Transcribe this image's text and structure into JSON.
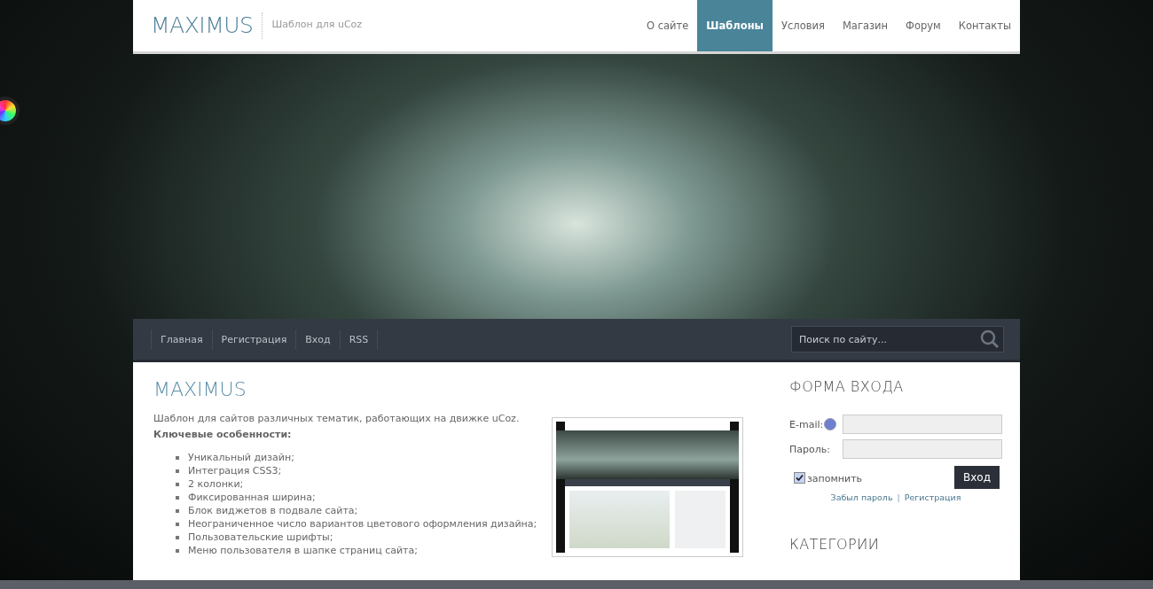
{
  "header": {
    "logo": "MAXIMUS",
    "tagline": "Шаблон для uCoz",
    "nav": [
      {
        "label": "О сайте",
        "selected": false
      },
      {
        "label": "Шаблоны",
        "selected": true
      },
      {
        "label": "Условия",
        "selected": false
      },
      {
        "label": "Магазин",
        "selected": false
      },
      {
        "label": "Форум",
        "selected": false
      },
      {
        "label": "Контакты",
        "selected": false
      }
    ]
  },
  "subnav": {
    "links": [
      "Главная",
      "Регистрация",
      "Вход",
      "RSS"
    ],
    "search": {
      "placeholder": "Поиск по сайту..."
    }
  },
  "content": {
    "title": "MAXIMUS",
    "intro": "Шаблон для сайтов различных тематик, работающих на движке uCoz.",
    "features_heading": "Ключевые особенности:",
    "features": [
      "Уникальный дизайн;",
      "Интеграция CSS3;",
      "2 колонки;",
      "Фиксированная ширина;",
      "Блок виджетов в подвале сайта;",
      "Неограниченное число вариантов цветового оформления дизайна;",
      "Пользовательские шрифты;",
      "Меню пользователя в шапке страниц сайта;"
    ]
  },
  "login": {
    "title": "ФОРМА ВХОДА",
    "email_label": "E-mail:",
    "password_label": "Пароль:",
    "remember": {
      "label": "запомнить",
      "checked": true
    },
    "submit": "Вход",
    "forgot": "Забыл пароль",
    "separator": "|",
    "register": "Регистрация"
  },
  "categories": {
    "title": "КАТЕГОРИИ"
  }
}
